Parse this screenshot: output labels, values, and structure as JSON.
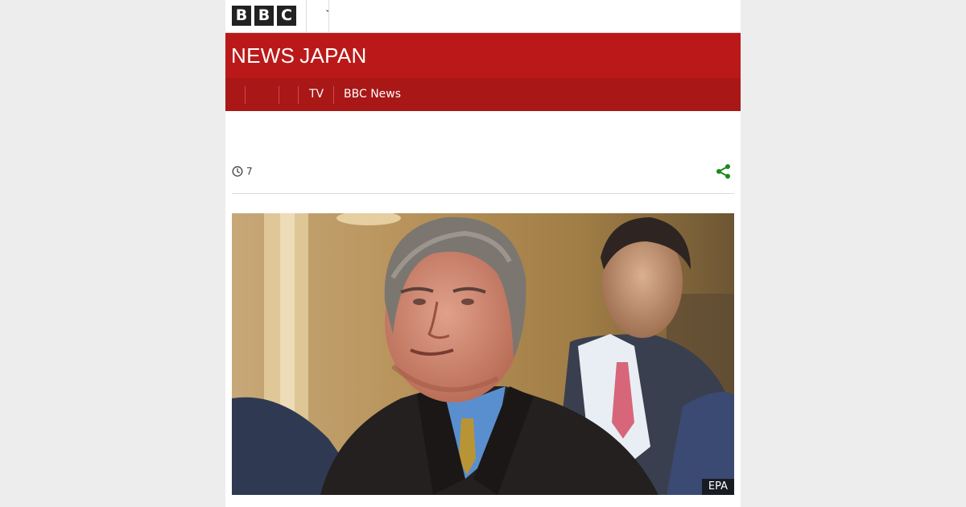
{
  "masthead": {
    "logo_letters": [
      "B",
      "B",
      "C"
    ],
    "menu_caret": "ˇ"
  },
  "banner": {
    "title_news": "NEWS",
    "title_japan": "JAPAN"
  },
  "nav": {
    "items": [
      {
        "label": "TV"
      },
      {
        "label": "BBC News"
      }
    ]
  },
  "article": {
    "date_text": "7",
    "photo_credit": "EPA"
  },
  "colors": {
    "brand_red": "#bb1919",
    "nav_red": "#a91717",
    "share_green": "#1a8a1a"
  },
  "icons": {
    "time": "clock-icon",
    "share": "share-icon"
  }
}
